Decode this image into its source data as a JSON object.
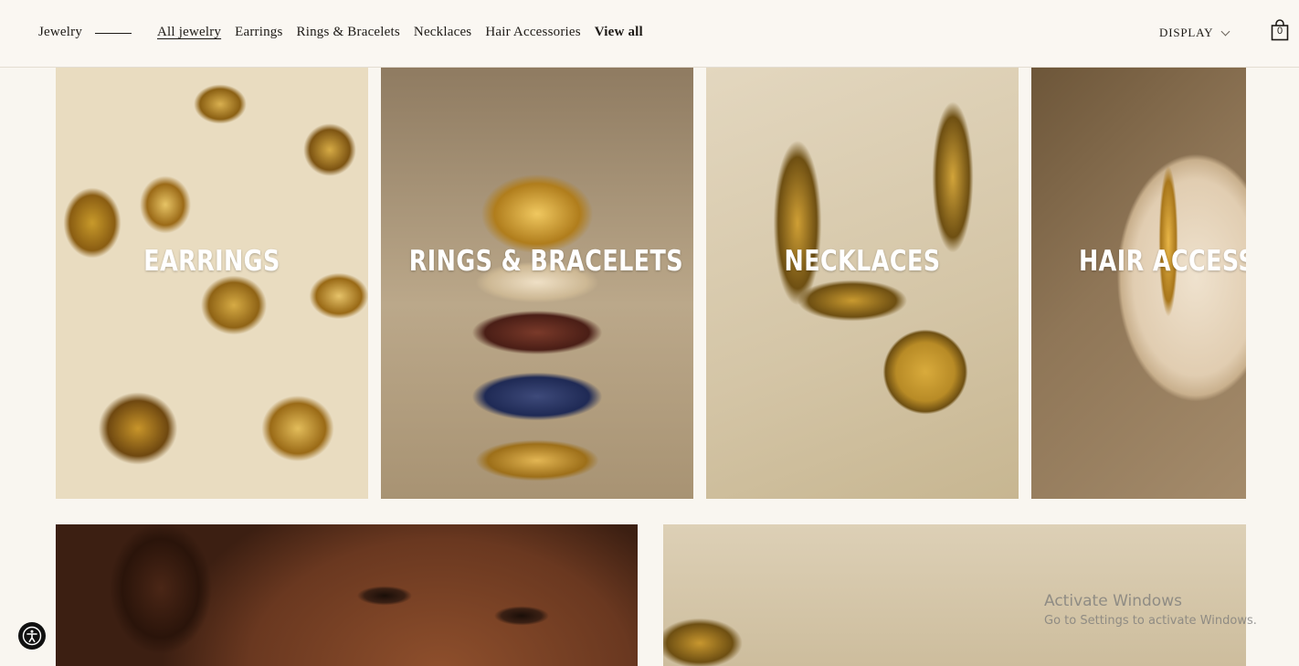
{
  "header": {
    "brand": "Jewelry",
    "nav": [
      {
        "label": "All jewelry",
        "active": true
      },
      {
        "label": "Earrings"
      },
      {
        "label": "Rings & Bracelets"
      },
      {
        "label": "Necklaces"
      },
      {
        "label": "Hair Accessories"
      },
      {
        "label": "View all",
        "bold": true
      }
    ],
    "display_label": "DISPLAY",
    "cart_count": "0"
  },
  "categories": [
    {
      "label": "EARRINGS"
    },
    {
      "label": "RINGS & BRACELETS"
    },
    {
      "label": "NECKLACES"
    },
    {
      "label": "HAIR ACCESSORIES"
    }
  ],
  "watermark": {
    "title": "Activate Windows",
    "subtitle": "Go to Settings to activate Windows."
  },
  "icons": {
    "cart": "shopping-bag-icon",
    "display": "chevron-down-icon",
    "accessibility": "accessibility-icon"
  },
  "colors": {
    "background": "#f9f6f0",
    "text": "#1d1a16",
    "tile_label": "#ffffff"
  }
}
